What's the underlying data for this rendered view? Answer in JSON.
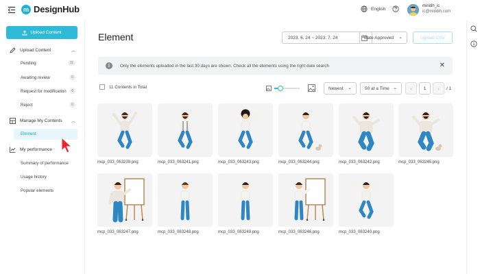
{
  "app": {
    "logo_mark": "m",
    "logo_text": "DesignHub"
  },
  "header": {
    "language": "English",
    "user_name": "miridih_ic",
    "user_email": "ic@miridih.com"
  },
  "sidebar": {
    "upload_button": "Upload Content",
    "upload_section": "Upload Content",
    "upload_items": [
      {
        "label": "Pending",
        "count": "11"
      },
      {
        "label": "Awaiting review",
        "count": "0"
      },
      {
        "label": "Request for modification",
        "count": "0"
      },
      {
        "label": "Reject",
        "count": "0"
      }
    ],
    "manage_section": "Manage My Contents",
    "manage_items": [
      {
        "label": "Element"
      }
    ],
    "performance_section": "My performance",
    "performance_items": [
      {
        "label": "Summary of performance"
      },
      {
        "label": "Usage history"
      },
      {
        "label": "Popular elements"
      }
    ]
  },
  "main": {
    "title": "Element",
    "date_range": "2023. 6. 24 ~ 2023. 7. 24",
    "sort_field": "Date Approved",
    "csv_button": "Upload CSV",
    "notice": "Only the elements uploaded in the last 30 days are shown. Check all the elements using the right date search",
    "total": "11 Contents in Total",
    "zoom_level": 0.25,
    "sort_order": "Newest",
    "per_page": "50 at a Time",
    "current_page": "1",
    "total_pages": "/ 1",
    "prev": "‹",
    "next": "›"
  },
  "items": [
    {
      "file": "mcp_033_063239.png",
      "pose": "jump-fist",
      "hair": "#3a2a1e",
      "shirt": "#ece7dc",
      "pants": "#2f86c2",
      "beard": true
    },
    {
      "file": "mcp_033_063241.png",
      "pose": "jump-spread",
      "hair": "#3a2a1e",
      "shirt": "#f3f3f0",
      "pants": "#2f86c2",
      "beard": true,
      "suspenders": true
    },
    {
      "file": "mcp_033_063243.png",
      "pose": "jump-cheer",
      "hair": "#1e1712",
      "shirt": "#f4f2ee",
      "pants": "#2f86c2",
      "afro": true
    },
    {
      "file": "mcp_033_063244.png",
      "pose": "jump-dog",
      "hair": "#2b2019",
      "shirt": "#f3f3f0",
      "pants": "#2f86c2",
      "dog": true
    },
    {
      "file": "mcp_033_063242.png",
      "pose": "jump-big",
      "hair": "#2b2019",
      "shirt": "#ece7dc",
      "pants": "#2f86c2",
      "beard": true,
      "big": true
    },
    {
      "file": "mcp_033_063245.png",
      "pose": "jump-dog2",
      "hair": "#2b2019",
      "shirt": "#ece7dc",
      "pants": "#2f86c2",
      "beard": true,
      "big": true,
      "dog": true
    },
    {
      "file": "mcp_033_063247.png",
      "pose": "board-big",
      "hair": "#2b2019",
      "shirt": "#ece7dc",
      "pants": "#2f86c2",
      "big": true,
      "board": true
    },
    {
      "file": "mcp_033_063248.png",
      "pose": "stand-think",
      "hair": "#5b3a22",
      "shirt": "#f3f3f0",
      "pants": "#2f86c2"
    },
    {
      "file": "mcp_033_063249.png",
      "pose": "stand-phone",
      "hair": "#2b2019",
      "shirt": "#f3f3f0",
      "pants": "#2f86c2"
    },
    {
      "file": "mcp_033_063246.png",
      "pose": "board-woman",
      "hair": "#3a2a1e",
      "shirt": "#f3f3f0",
      "pants": "#2f86c2",
      "board": true
    },
    {
      "file": "mcp_033_063240.png",
      "pose": "jump-flex",
      "hair": "#2b2019",
      "shirt": "#f4f2ee",
      "pants": "#2f86c2"
    }
  ],
  "colors": {
    "accent": "#2ebad6",
    "active_bg": "#e6f6fa",
    "cursor": "#e8262b"
  },
  "icons": {
    "menu": "menu-collapse-icon",
    "globe": "globe-icon",
    "help": "help-icon",
    "upload": "upload-icon",
    "pencil": "pencil-icon",
    "manage": "grid-layout-icon",
    "performance": "chart-icon",
    "calendar": "calendar-icon",
    "info": "info-icon",
    "close": "close-icon",
    "search": "search-icon"
  }
}
